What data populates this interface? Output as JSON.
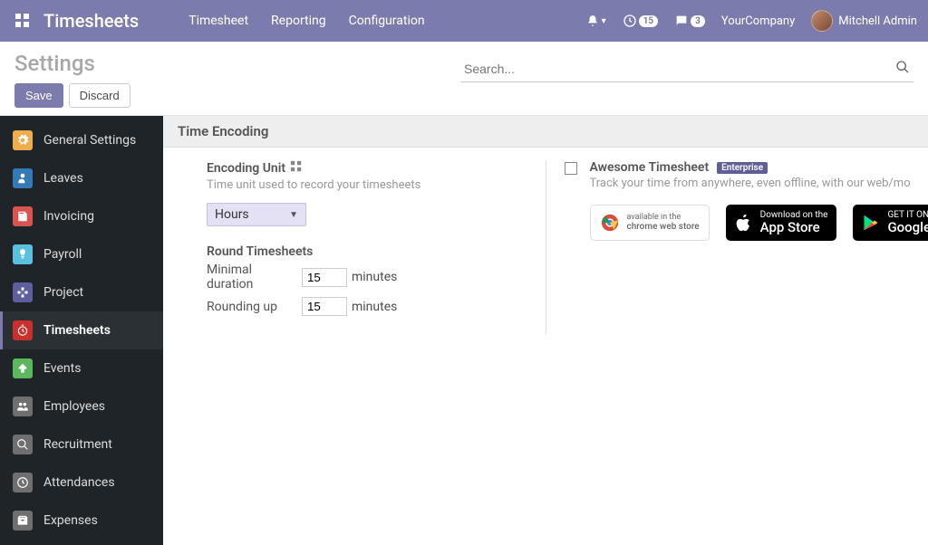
{
  "navbar": {
    "brand": "Timesheets",
    "menu": [
      "Timesheet",
      "Reporting",
      "Configuration"
    ],
    "activities_count": "15",
    "messages_count": "3",
    "company": "YourCompany",
    "user": "Mitchell Admin"
  },
  "cp": {
    "title": "Settings",
    "search_placeholder": "Search...",
    "save": "Save",
    "discard": "Discard"
  },
  "sidebar": {
    "items": [
      {
        "label": "General Settings",
        "color": "#f0ad4e"
      },
      {
        "label": "Leaves",
        "color": "#337ab7"
      },
      {
        "label": "Invoicing",
        "color": "#d9534f"
      },
      {
        "label": "Payroll",
        "color": "#5bc0de"
      },
      {
        "label": "Project",
        "color": "#5e5e9e"
      },
      {
        "label": "Timesheets",
        "color": "#c9302c"
      },
      {
        "label": "Events",
        "color": "#5cb85c"
      },
      {
        "label": "Employees",
        "color": "#6f6f6f"
      },
      {
        "label": "Recruitment",
        "color": "#6f6f6f"
      },
      {
        "label": "Attendances",
        "color": "#6f6f6f"
      },
      {
        "label": "Expenses",
        "color": "#6f6f6f"
      }
    ]
  },
  "section": {
    "title": "Time Encoding"
  },
  "encoding": {
    "title": "Encoding Unit",
    "desc": "Time unit used to record your timesheets",
    "value": "Hours"
  },
  "round": {
    "title": "Round Timesheets",
    "minimal_label": "Minimal duration",
    "minimal_value": "15",
    "rounding_label": "Rounding up",
    "rounding_value": "15",
    "unit": "minutes"
  },
  "awesome": {
    "title": "Awesome Timesheet",
    "tag": "Enterprise",
    "desc": "Track your time from anywhere, even offline, with our web/mobile app",
    "chrome_small": "available in the",
    "chrome_big": "chrome web store",
    "apple_small": "Download on the",
    "apple_big": "App Store",
    "google_small": "GET IT ON",
    "google_big": "Google play"
  }
}
